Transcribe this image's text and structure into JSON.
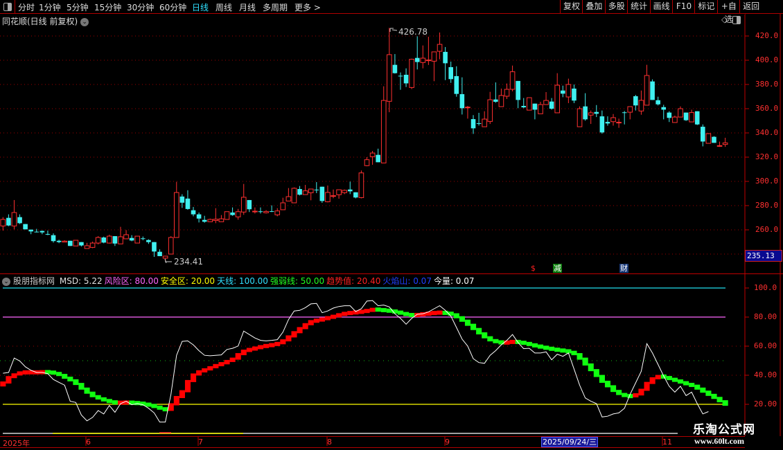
{
  "toolbar": {
    "periods": [
      "分时",
      "1分钟",
      "5分钟",
      "15分钟",
      "30分钟",
      "60分钟",
      "日线",
      "周线",
      "月线",
      "多周期",
      "更多 >"
    ],
    "active_period": "日线",
    "right_buttons": [
      "复权",
      "叠加",
      "多股",
      "统计",
      "画线",
      "F10",
      "标记",
      "+自选",
      "返回"
    ]
  },
  "chart_header": {
    "title": "同花顺(日线 前复权)",
    "diamond": "◇"
  },
  "price_axis": {
    "labels": [
      "420.0",
      "400.0",
      "380.0",
      "360.0",
      "340.0",
      "320.0",
      "300.0",
      "280.0",
      "260.0"
    ],
    "cursor_value": "235.13"
  },
  "annotations": {
    "high": "426.78",
    "low": "234.41"
  },
  "event_marks": [
    {
      "text": "$",
      "color": "#ff2020",
      "bg": "transparent"
    },
    {
      "text": "减",
      "color": "#ffffff",
      "bg": "#108010"
    },
    {
      "text": "财",
      "color": "#ffffff",
      "bg": "#1a3a7a"
    }
  ],
  "indicator": {
    "name": "股朋指标网",
    "fields": [
      {
        "label": "MSD: 5.22",
        "color": "#e0e0e0"
      },
      {
        "label": "风险区: 80.00",
        "color": "#ff66ff"
      },
      {
        "label": "安全区: 20.00",
        "color": "#ffff00"
      },
      {
        "label": "天线: 100.00",
        "color": "#30e0ff"
      },
      {
        "label": "强弱线: 50.00",
        "color": "#20ff20"
      },
      {
        "label": "趋势值: 20.40",
        "color": "#ff2020"
      },
      {
        "label": "火焰山: 0.07",
        "color": "#2040ff"
      },
      {
        "label": "今量: 0.07",
        "color": "#ffffff"
      }
    ],
    "axis_labels": [
      "100.0",
      "80.00",
      "60.00",
      "40.00",
      "20.00"
    ]
  },
  "date_axis": {
    "labels": [
      "2025年",
      "6",
      "7",
      "8",
      "9",
      "11"
    ],
    "cursor_date": "2025/09/24/三"
  },
  "watermark": {
    "line1": "乐淘公式网",
    "line2": "www.60lt.com"
  },
  "colors": {
    "up": "#ff3030",
    "down": "#40f0f0",
    "grid": "#a00000",
    "rise": "#ff0000",
    "fall": "#10ff10",
    "sky": "#20e0f0",
    "risk": "#ff66ff",
    "safe": "#ffff00"
  },
  "chart_data": {
    "type": "candlestick",
    "price_ylim": [
      240,
      420
    ],
    "candles": [
      [
        263.2,
        270.5,
        259.4,
        268.6
      ],
      [
        269.9,
        272.8,
        263,
        263.6
      ],
      [
        263.2,
        284.6,
        260.4,
        274.3
      ],
      [
        270.5,
        272.8,
        264.8,
        265.5
      ],
      [
        264.8,
        264.8,
        260.4,
        260.4
      ],
      [
        260.2,
        260.2,
        256.4,
        258.7
      ],
      [
        258.5,
        260.8,
        257.9,
        258.3
      ],
      [
        259.1,
        259.4,
        256.4,
        257.9
      ],
      [
        256.6,
        259.4,
        255.6,
        256.4
      ],
      [
        255.6,
        257.1,
        249.5,
        250.7
      ],
      [
        251,
        251.8,
        249,
        249.9
      ],
      [
        249.9,
        251.4,
        249.9,
        250.7
      ],
      [
        251,
        251,
        246.7,
        246.7
      ],
      [
        246.7,
        251.4,
        246.7,
        251.4
      ],
      [
        249.9,
        249.9,
        246.3,
        247.1
      ],
      [
        244.6,
        249.3,
        244.6,
        246.9
      ],
      [
        245.5,
        250.3,
        244.9,
        249.1
      ],
      [
        249.1,
        254.8,
        248,
        253.7
      ],
      [
        253.7,
        254.4,
        248.9,
        249.5
      ],
      [
        249.1,
        256,
        248.7,
        254.8
      ],
      [
        254.8,
        254.8,
        246.7,
        248.7
      ],
      [
        248.4,
        262.5,
        248.4,
        254.3
      ],
      [
        252.6,
        259.8,
        252.6,
        256
      ],
      [
        253.3,
        255.6,
        250.6,
        251.2
      ],
      [
        249.1,
        254.8,
        249.1,
        254.8
      ],
      [
        253,
        254.5,
        251.4,
        252.9
      ],
      [
        251.6,
        252.2,
        248.4,
        249.9
      ],
      [
        249.9,
        249.9,
        237.7,
        242.1
      ],
      [
        241.9,
        243.9,
        238.3,
        238.3
      ],
      [
        236.6,
        238.3,
        234.41,
        238.3
      ],
      [
        240,
        254.8,
        240,
        253.7
      ],
      [
        253.7,
        299.6,
        253.7,
        290.8
      ],
      [
        287.5,
        289.4,
        278.1,
        282.4
      ],
      [
        285.8,
        292.7,
        276.6,
        277.2
      ],
      [
        276.2,
        278.9,
        271.2,
        272.8
      ],
      [
        272.8,
        274.3,
        266.1,
        269.3
      ],
      [
        268.2,
        271.6,
        265.9,
        266.7
      ],
      [
        266.7,
        269.3,
        266.7,
        268.6
      ],
      [
        267.7,
        277.9,
        265.5,
        268.8
      ],
      [
        266.7,
        272.2,
        266.7,
        269.1
      ],
      [
        268.6,
        275,
        268.6,
        275
      ],
      [
        274.3,
        278.5,
        271.6,
        272.2
      ],
      [
        270.7,
        277.3,
        268.4,
        275
      ],
      [
        274.7,
        297.9,
        272.4,
        286.9
      ],
      [
        284.6,
        284.6,
        274.7,
        277
      ],
      [
        275.2,
        278.5,
        273.5,
        275.4
      ],
      [
        275.3,
        278.5,
        273.5,
        275.1
      ],
      [
        274.1,
        276.2,
        273.5,
        275.2
      ],
      [
        275.4,
        280.2,
        274.7,
        275.3
      ],
      [
        272.4,
        277.9,
        271.2,
        275.6
      ],
      [
        276.6,
        286.5,
        276.6,
        282.3
      ],
      [
        283.8,
        294.5,
        283.8,
        287.4
      ],
      [
        282.3,
        295,
        282.3,
        294.3
      ],
      [
        293.7,
        296.2,
        288.4,
        289
      ],
      [
        289.1,
        297.1,
        289.1,
        292.2
      ],
      [
        290.6,
        293.7,
        284.4,
        293.7
      ],
      [
        293.2,
        299.4,
        290.3,
        293
      ],
      [
        295.6,
        295.6,
        282.3,
        283.8
      ],
      [
        283.2,
        296.6,
        282.7,
        290.9
      ],
      [
        288,
        293.3,
        286.1,
        288.2
      ],
      [
        289,
        293.1,
        285.7,
        293.1
      ],
      [
        290.7,
        293.3,
        289.5,
        292.6
      ],
      [
        293.3,
        299.8,
        289.5,
        291.8
      ],
      [
        291,
        291,
        286,
        286.7
      ],
      [
        286.6,
        309,
        286,
        307
      ],
      [
        313,
        320,
        312.5,
        317.9
      ],
      [
        320.4,
        325.1,
        313.7,
        323.4
      ],
      [
        321.9,
        327,
        315.8,
        315.8
      ],
      [
        315.2,
        378.5,
        315.2,
        366.8
      ],
      [
        366.1,
        426.78,
        357.1,
        404.6
      ],
      [
        396.2,
        405.1,
        389,
        389.3
      ],
      [
        387.2,
        389.9,
        375.6,
        387
      ],
      [
        388,
        393.3,
        377.9,
        380.9
      ],
      [
        377.5,
        401.3,
        376.2,
        400.8
      ],
      [
        401.9,
        419.8,
        392.4,
        398.5
      ],
      [
        398.1,
        412.2,
        393.3,
        401.7
      ],
      [
        400,
        419.4,
        396.1,
        400.2
      ],
      [
        399.2,
        406.9,
        382.7,
        406.9
      ],
      [
        407.4,
        422.9,
        400.8,
        413.1
      ],
      [
        406.9,
        410.9,
        383.6,
        397.5
      ],
      [
        394.3,
        398.9,
        381.3,
        384.4
      ],
      [
        386.9,
        395,
        369.9,
        372.2
      ],
      [
        372,
        385.9,
        355.2,
        360.4
      ],
      [
        361.1,
        362.3,
        351.8,
        361.3
      ],
      [
        351.4,
        354.7,
        339.2,
        343.8
      ],
      [
        348,
        356.6,
        346.1,
        347.8
      ],
      [
        345.1,
        357.9,
        345.1,
        351.4
      ],
      [
        349.5,
        373.9,
        347.4,
        367.4
      ],
      [
        367.6,
        381.7,
        364.9,
        365.7
      ],
      [
        361.7,
        376.6,
        361.7,
        370.9
      ],
      [
        370.3,
        380.8,
        368,
        376
      ],
      [
        376,
        395.6,
        374.3,
        390.5
      ],
      [
        382.9,
        382.9,
        360.4,
        367.2
      ],
      [
        362.3,
        368.8,
        360.4,
        361.1
      ],
      [
        358.8,
        369.1,
        358.8,
        369.1
      ],
      [
        364.2,
        364.2,
        351.2,
        359.2
      ],
      [
        355.8,
        365.7,
        355.8,
        363.4
      ],
      [
        363.4,
        373.7,
        363.4,
        366.8
      ],
      [
        365.9,
        368.8,
        359.2,
        360
      ],
      [
        356.6,
        389.3,
        356.6,
        379.4
      ],
      [
        375,
        379,
        369.5,
        372.4
      ],
      [
        369.7,
        384.8,
        364.6,
        380
      ],
      [
        376.6,
        380,
        364.6,
        366.7
      ],
      [
        345.1,
        361.9,
        345.1,
        360
      ],
      [
        361.9,
        372.8,
        350.1,
        351.2
      ],
      [
        354.7,
        358.5,
        347.4,
        356.6
      ],
      [
        357.3,
        363,
        353.1,
        355.8
      ],
      [
        353.7,
        358.5,
        339.4,
        340.4
      ],
      [
        349.1,
        353.7,
        346,
        347.8
      ],
      [
        349.3,
        355.6,
        346,
        352.6
      ],
      [
        348.7,
        351.8,
        344.2,
        348.8
      ],
      [
        357,
        358.1,
        347,
        356.9
      ],
      [
        357.1,
        361.7,
        351.2,
        361.7
      ],
      [
        370.3,
        371.4,
        358.5,
        362.7
      ],
      [
        358.1,
        375,
        355,
        366.9
      ],
      [
        362.9,
        396.2,
        362.9,
        387.4
      ],
      [
        382.5,
        384.2,
        367.2,
        367.2
      ],
      [
        367,
        369.9,
        362.7,
        363.6
      ],
      [
        361.3,
        363.2,
        351.2,
        359.2
      ],
      [
        356.8,
        357.9,
        349,
        352.4
      ],
      [
        348.6,
        354.3,
        348.6,
        353.1
      ],
      [
        353.1,
        361.9,
        353.1,
        360
      ],
      [
        356.8,
        356.8,
        349.9,
        350.5
      ],
      [
        349.1,
        359.2,
        349.1,
        356.8
      ],
      [
        357.9,
        357.9,
        346.5,
        347
      ],
      [
        345.1,
        347,
        328.9,
        332.9
      ],
      [
        331.4,
        339.8,
        331.4,
        339.4
      ],
      [
        336.8,
        337.3,
        331.8,
        331.8
      ],
      [
        329.3,
        332.8,
        328.5,
        329.5
      ],
      [
        330.5,
        336,
        328.5,
        331.8
      ]
    ],
    "indicator_ylim": [
      10,
      100
    ],
    "reference_lines": {
      "sky": 100,
      "risk": 80,
      "strong_weak": 50,
      "safe": 20
    },
    "trend": [
      35,
      38.7,
      40.6,
      41.9,
      42,
      42,
      42,
      42.2,
      42.1,
      41.5,
      40.2,
      38.3,
      36.5,
      34,
      30.8,
      28,
      25.6,
      24,
      22.8,
      21.7,
      21,
      21.2,
      21.3,
      21,
      20.7,
      20.2,
      19.3,
      18.4,
      17,
      16.2,
      20,
      25,
      29,
      36,
      40.5,
      42.7,
      44,
      45.5,
      47,
      48.2,
      49.8,
      51.4,
      54.5,
      56.9,
      57.9,
      58.8,
      59.8,
      60.4,
      61,
      62,
      64,
      66.7,
      69.6,
      72.4,
      75.1,
      77.2,
      77.8,
      78.8,
      79.7,
      80.7,
      81.8,
      82.6,
      83,
      83.4,
      83.8,
      84.6,
      85.3,
      85,
      84.6,
      84.2,
      83.5,
      82.6,
      81.6,
      81.2,
      81.7,
      82.1,
      82.6,
      83,
      83.1,
      82.7,
      81.9,
      79.9,
      77.5,
      74.7,
      71.8,
      68.8,
      66.1,
      64,
      62.9,
      62.3,
      62.6,
      63.2,
      62.6,
      62,
      61,
      60.1,
      59.3,
      58.5,
      57.9,
      57.2,
      56.8,
      56.1,
      54.5,
      51.4,
      47.4,
      43.5,
      39.5,
      35.5,
      32.4,
      29.2,
      27.1,
      25.7,
      25.6,
      26.8,
      30,
      34.7,
      37.9,
      39.5,
      38.7,
      37.4,
      36.3,
      35.1,
      33.9,
      32.8,
      30.8,
      28.7,
      26.5,
      24.4,
      22.1,
      19.7
    ],
    "msd": [
      41.4,
      41.9,
      51.8,
      49.8,
      45.8,
      43.4,
      41.9,
      41.9,
      41.1,
      37.1,
      35.1,
      33.2,
      22.1,
      21.3,
      12.6,
      8.6,
      11,
      15.7,
      13.4,
      19.2,
      14.5,
      20.5,
      22.1,
      19.7,
      20.5,
      19.7,
      17.3,
      14.1,
      7.8,
      7.8,
      26.8,
      53.7,
      63.3,
      63.6,
      60.9,
      56.9,
      53.7,
      53.4,
      53.7,
      54,
      57.7,
      58.5,
      60.1,
      70.4,
      68,
      65.6,
      64,
      63.6,
      64,
      64.5,
      69.6,
      78.3,
      84.2,
      84.6,
      86.5,
      89.1,
      89.4,
      83,
      84.2,
      86.2,
      87.3,
      87.8,
      87.8,
      83.8,
      85.7,
      91,
      91.4,
      87.8,
      88.3,
      87,
      82.3,
      79.1,
      75.1,
      79.1,
      81.9,
      82.3,
      83.5,
      85.7,
      87.8,
      84.6,
      80.7,
      72.8,
      64.8,
      60.1,
      51.4,
      48.7,
      48.2,
      53.7,
      56.9,
      60.9,
      64,
      68,
      62.5,
      58.3,
      58.5,
      55.3,
      55.3,
      56.1,
      50.6,
      54.5,
      53,
      55.3,
      44.2,
      33.2,
      24.4,
      22.1,
      20.5,
      11.3,
      11.8,
      13.4,
      14.1,
      17.3,
      26.8,
      34.7,
      42.7,
      61.7,
      55.3,
      47.4,
      39.5,
      32.4,
      28.4,
      32.4,
      26,
      28.4,
      20.5,
      13.4,
      15,
      null,
      null,
      null
    ]
  }
}
